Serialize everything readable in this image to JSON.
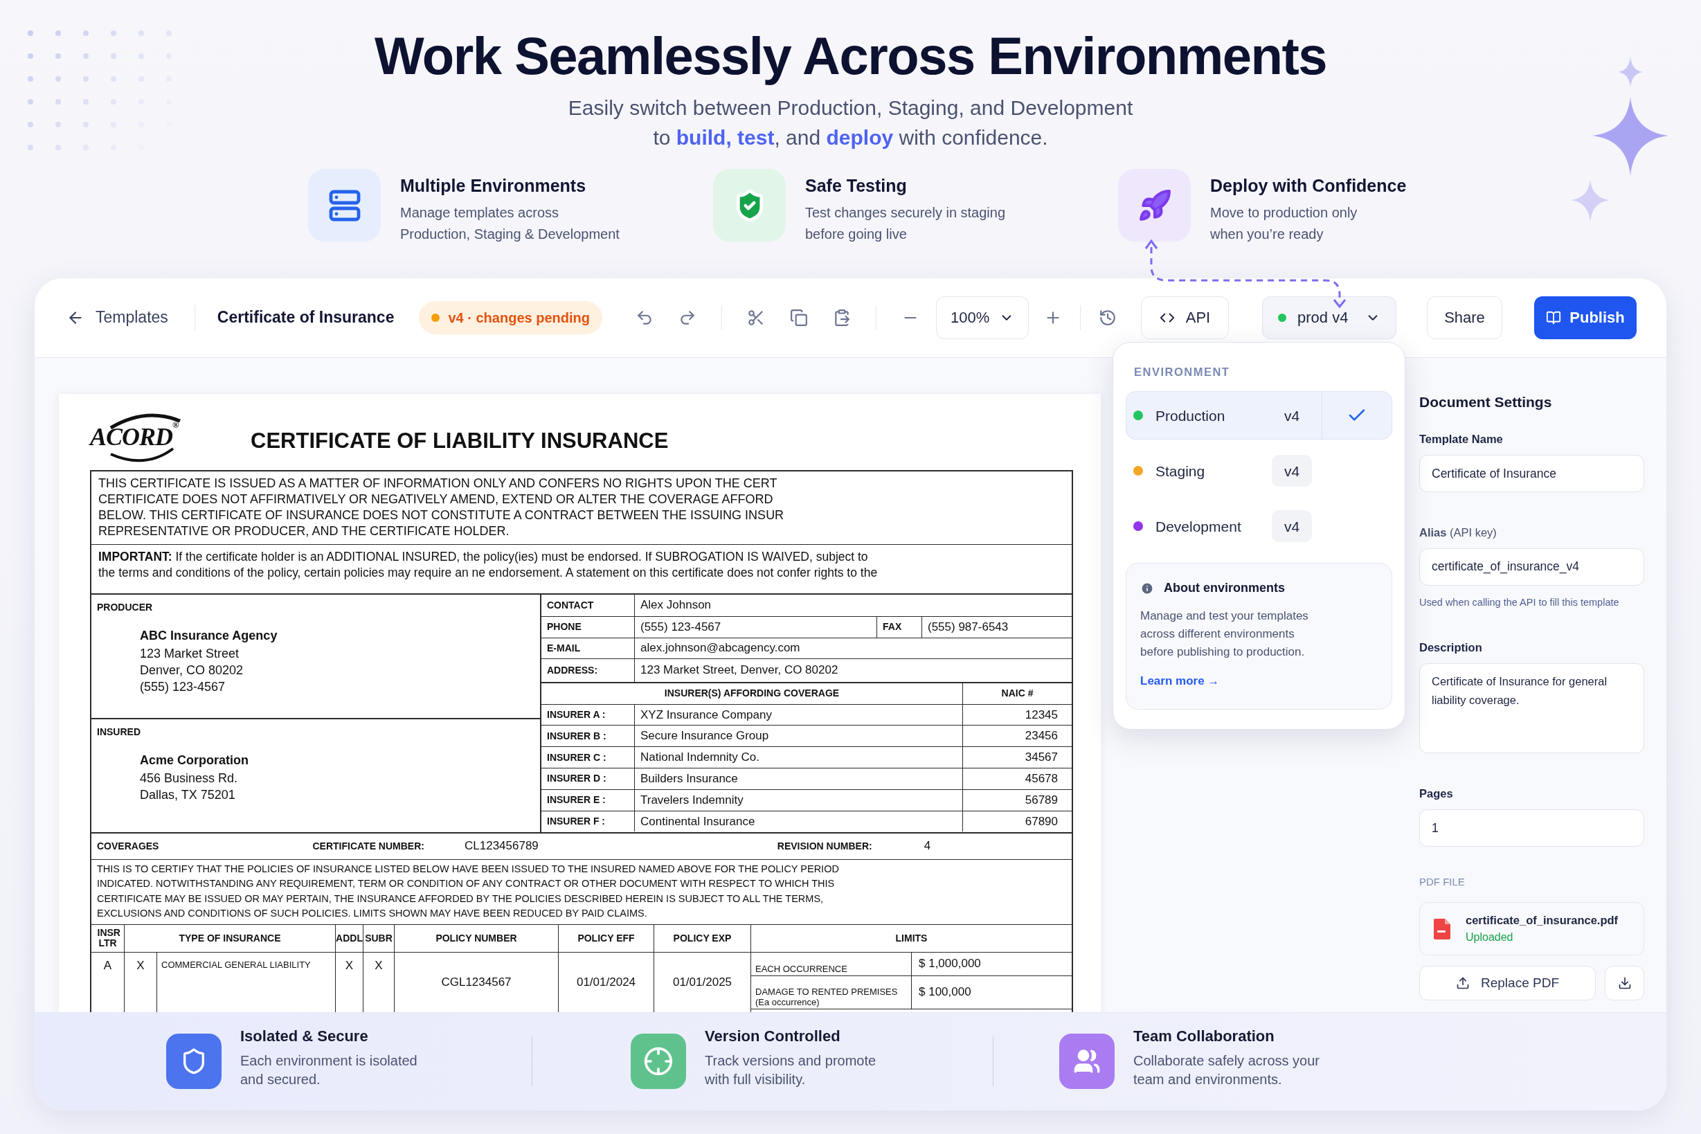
{
  "hero": {
    "title": "Work Seamlessly Across Environments",
    "subtitle_lines": [
      "Easily switch between Production, Staging, and Development",
      "to **build, test**, and **deploy** with confidence."
    ]
  },
  "features": [
    {
      "title": "Multiple Environments",
      "lines": [
        "Manage templates across",
        "Production, Staging & Development"
      ]
    },
    {
      "title": "Safe Testing",
      "lines": [
        "Test changes securely in staging",
        "before going live"
      ]
    },
    {
      "title": "Deploy with Confidence",
      "lines": [
        "Move to production only",
        "when you’re ready"
      ]
    }
  ],
  "toolbar": {
    "back": "Templates",
    "title": "Certificate of Insurance",
    "status": "v4 · changes pending",
    "zoom": "100%",
    "api": "API",
    "environment": "prod v4",
    "share": "Share",
    "publish": "Publish"
  },
  "environment_menu": {
    "heading": "ENVIRONMENT",
    "options": [
      {
        "name": "Production",
        "version": "v4",
        "color": "#22c55e",
        "selected": true
      },
      {
        "name": "Staging",
        "version": "v4",
        "color": "#f5a623",
        "selected": false
      },
      {
        "name": "Development",
        "version": "v4",
        "color": "#9333ea",
        "selected": false
      }
    ],
    "about": {
      "title": "About environments",
      "lines": [
        "Manage and test your templates",
        "across different environments",
        "before publishing to production."
      ],
      "link": "Learn more →"
    }
  },
  "document": {
    "logo": "ACORD",
    "logo_mark": "®",
    "title": "CERTIFICATE OF LIABILITY INSURANCE",
    "notice_lines": [
      "THIS CERTIFICATE IS ISSUED AS A MATTER OF INFORMATION ONLY AND CONFERS NO RIGHTS UPON THE CERT",
      "CERTIFICATE DOES NOT AFFIRMATIVELY OR NEGATIVELY AMEND, EXTEND OR ALTER THE COVERAGE AFFORD",
      "BELOW.   THIS CERTIFICATE OF INSURANCE DOES NOT CONSTITUTE A CONTRACT BETWEEN THE ISSUING INSUR",
      "REPRESENTATIVE OR PRODUCER, AND THE CERTIFICATE HOLDER."
    ],
    "important_lines": [
      "**IMPORTANT:**  If the certificate holder is an ADDITIONAL INSURED, the policy(ies) must be endorsed.  If SUBROGATION IS WAIVED, subject to",
      "the terms and conditions of the policy, certain policies may require an ne endorsement.  A statement on this certificate does not confer rights to the"
    ],
    "producer": {
      "label": "PRODUCER",
      "name": "ABC Insurance Agency",
      "lines": [
        "123 Market Street",
        "Denver, CO 80202",
        "(555) 123-4567"
      ]
    },
    "insured": {
      "label": "INSURED",
      "name": "Acme Corporation",
      "lines": [
        "456 Business Rd.",
        "Dallas, TX 75201"
      ]
    },
    "contact": {
      "contact_label": "CONTACT",
      "contact": "Alex Johnson",
      "phone_label": "PHONE",
      "phone": "(555) 123-4567",
      "fax_label": "FAX",
      "fax": "(555) 987-6543",
      "email_label": "E-MAIL",
      "email": "alex.johnson@abcagency.com",
      "address_label": "ADDRESS:",
      "address": "123 Market Street, Denver, CO 80202"
    },
    "insurers_heading": "INSURER(S) AFFORDING COVERAGE",
    "naic_heading": "NAIC #",
    "insurers": [
      {
        "label": "INSURER A :",
        "name": "XYZ Insurance Company",
        "naic": "12345"
      },
      {
        "label": "INSURER B :",
        "name": "Secure Insurance Group",
        "naic": "23456"
      },
      {
        "label": "INSURER C :",
        "name": "National Indemnity Co.",
        "naic": "34567"
      },
      {
        "label": "INSURER D :",
        "name": "Builders Insurance",
        "naic": "45678"
      },
      {
        "label": "INSURER E :",
        "name": "Travelers Indemnity",
        "naic": "56789"
      },
      {
        "label": "INSURER F :",
        "name": "Continental Insurance",
        "naic": "67890"
      }
    ],
    "coverages": {
      "label": "COVERAGES",
      "certificate_label": "CERTIFICATE NUMBER:",
      "certificate_number": "CL123456789",
      "revision_label": "REVISION NUMBER:",
      "revision_number": "4"
    },
    "certify_lines": [
      "THIS IS TO CERTIFY THAT THE POLICIES OF INSURANCE LISTED BELOW HAVE BEEN ISSUED TO THE INSURED NAMED ABOVE FOR THE POLICY PERIOD",
      "INDICATED. NOTWITHSTANDING ANY REQUIREMENT, TERM OR CONDITION OF ANY CONTRACT OR OTHER DOCUMENT WITH RESPECT TO WHICH THIS",
      "CERTIFICATE MAY BE ISSUED OR MAY PERTAIN, THE INSURANCE AFFORDED BY THE POLICIES DESCRIBED HEREIN IS SUBJECT TO ALL THE TERMS,",
      "EXCLUSIONS AND CONDITIONS OF SUCH POLICIES. LIMITS SHOWN MAY HAVE BEEN REDUCED BY PAID CLAIMS."
    ],
    "policy_columns": [
      "INSR LTR",
      "TYPE OF INSURANCE",
      "ADDL",
      "SUBR",
      "POLICY NUMBER",
      "POLICY EFF",
      "POLICY EXP",
      "LIMITS"
    ],
    "policies": [
      {
        "letter": "A",
        "mark": "X",
        "type": "COMMERCIAL GENERAL LIABILITY",
        "addl": "X",
        "subr": "X",
        "number": "CGL1234567",
        "effective": "01/01/2024",
        "expires": "01/01/2025",
        "limits": [
          {
            "label": "EACH OCCURRENCE",
            "amount": "$ 1,000,000"
          },
          {
            "label": "DAMAGE TO RENTED PREMISES (Ea occurrence)",
            "amount": "$ 100,000"
          }
        ]
      }
    ]
  },
  "settings": {
    "title": "Document Settings",
    "template_name": {
      "label": "Template Name",
      "value": "Certificate of Insurance"
    },
    "alias": {
      "label": "**Alias** (API key)",
      "value": "certificate_of_insurance_v4",
      "hint": "Used when calling the API to fill this template"
    },
    "description": {
      "label": "Description",
      "lines": [
        "Certificate of Insurance for general",
        "liability coverage."
      ]
    },
    "pages": {
      "label": "Pages",
      "value": "1"
    },
    "pdf": {
      "label": "PDF FILE",
      "file_name": "certificate_of_insurance.pdf",
      "status": "Uploaded",
      "replace": "Replace PDF"
    }
  },
  "highlights": [
    {
      "title": "Isolated & Secure",
      "lines": [
        "Each environment is isolated",
        "and secured."
      ]
    },
    {
      "title": "Version Controlled",
      "lines": [
        "Track versions and promote",
        "with full visibility."
      ]
    },
    {
      "title": "Team Collaboration",
      "lines": [
        "Collaborate safely across your",
        "team and environments."
      ]
    }
  ]
}
